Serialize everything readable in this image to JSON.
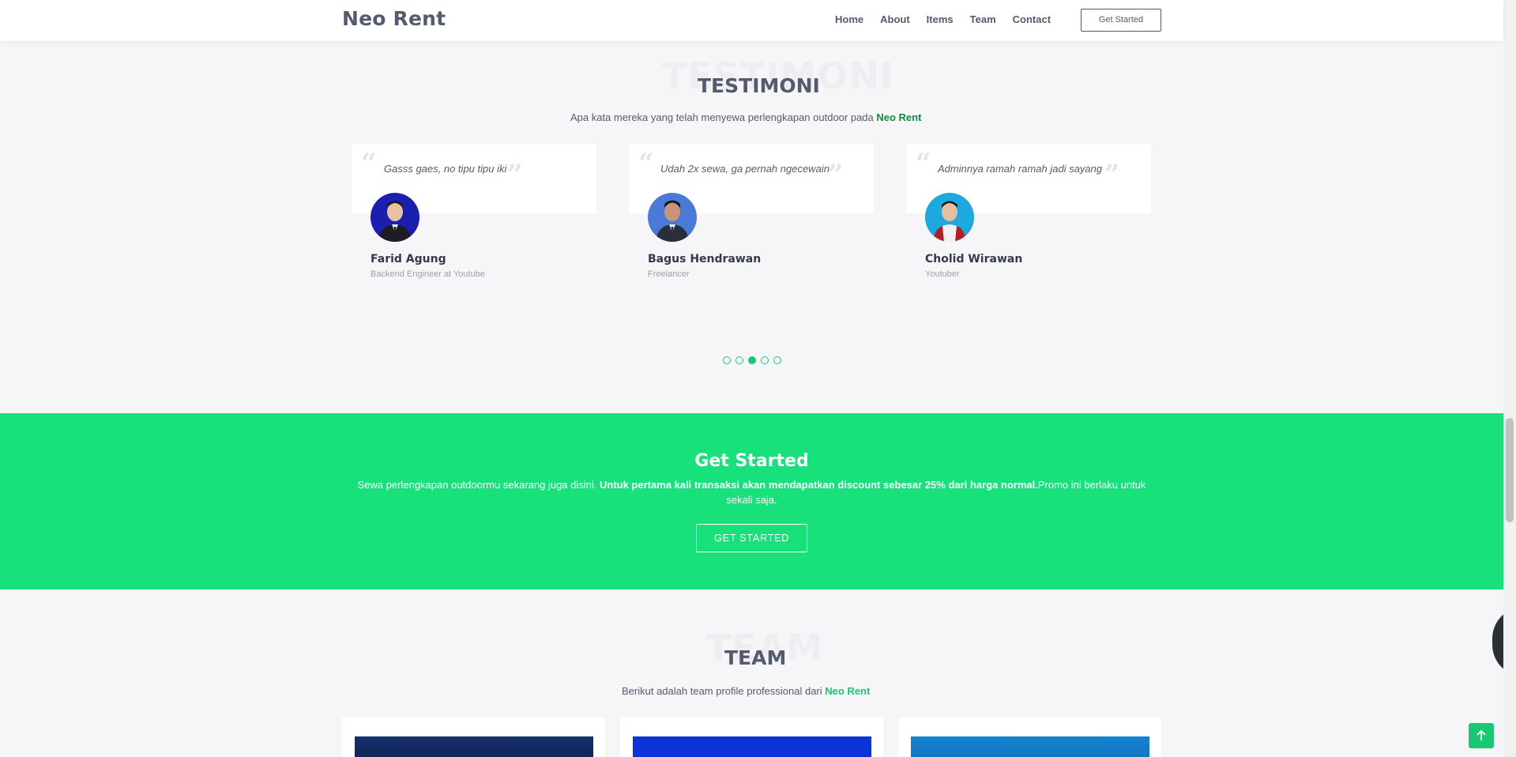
{
  "header": {
    "logo": "Neo Rent",
    "nav": [
      "Home",
      "About",
      "Items",
      "Team",
      "Contact"
    ],
    "cta": "Get Started"
  },
  "testimonials": {
    "bg_title": "TESTIMONI",
    "title": "TESTIMONI",
    "subtitle_pre": "Apa kata mereka yang telah menyewa perlengkapan outdoor pada ",
    "subtitle_brand": "Neo Rent",
    "items": [
      {
        "quote": "Gasss gaes, no tipu tipu iki",
        "name": "Farid Agung",
        "role": "Backend Engineer at Youtube"
      },
      {
        "quote": "Udah 2x sewa, ga pernah ngecewain",
        "name": "Bagus Hendrawan",
        "role": "Freelancer"
      },
      {
        "quote": "Adminnya ramah ramah jadi sayang",
        "name": "Cholid Wirawan",
        "role": "Youtuber"
      }
    ],
    "dots_count": 5,
    "active_dot": 3
  },
  "cta": {
    "title": "Get Started",
    "text_pre": "Sewa perlengkapan outdoormu sekarang juga disini. ",
    "text_bold": "Untuk pertama kali transaksi akan mendapatkan discount sebesar 25% dari harga normal.",
    "text_post": "Promo ini berlaku untuk sekali saja.",
    "button": "GET STARTED"
  },
  "team": {
    "bg_title": "TEAM",
    "title": "TEAM",
    "subtitle_pre": "Berikut adalah team profile professional dari ",
    "subtitle_brand": "Neo Rent"
  },
  "colors": {
    "accent": "#18c873",
    "cta_bg": "#18e07a",
    "brand_dark_green": "#108a3c",
    "text": "#555b6e"
  },
  "icons": {
    "back_to_top": "arrow-up-icon",
    "quote_open": "quote-open-icon",
    "quote_close": "quote-close-icon"
  }
}
